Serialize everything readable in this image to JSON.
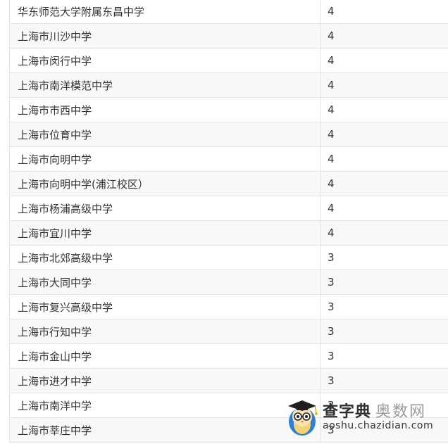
{
  "rows": [
    {
      "name": "华东师范大学附属东昌中学",
      "count": "4"
    },
    {
      "name": "上海市川沙中学",
      "count": "4"
    },
    {
      "name": "上海市闵行中学",
      "count": "4"
    },
    {
      "name": "上海市南洋模范中学",
      "count": "4"
    },
    {
      "name": "上海市市西中学",
      "count": "4"
    },
    {
      "name": "上海市位育中学",
      "count": "4"
    },
    {
      "name": "上海市向明中学",
      "count": "4"
    },
    {
      "name": "上海市向明中学(浦江校区）",
      "count": "4"
    },
    {
      "name": "上海市杨浦高级中学",
      "count": "4"
    },
    {
      "name": "上海市宜川中学",
      "count": "4"
    },
    {
      "name": "上海市北郊高级中学",
      "count": "3"
    },
    {
      "name": "上海市大同中学",
      "count": "3"
    },
    {
      "name": "上海市复兴高级中学",
      "count": "3"
    },
    {
      "name": "上海市行知中学",
      "count": "3"
    },
    {
      "name": "上海市金山中学",
      "count": "3"
    },
    {
      "name": "上海市进才中学",
      "count": "3"
    },
    {
      "name": "上海市南洋中学",
      "count": "3"
    },
    {
      "name": "上海市莘庄中学",
      "count": "3"
    }
  ],
  "watermark": {
    "brand": "查字典",
    "section": "奥数网",
    "url": "aoshu.chazidian.com"
  }
}
